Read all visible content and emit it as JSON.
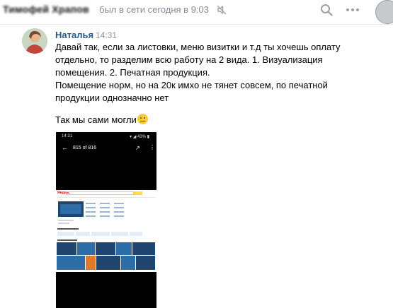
{
  "header": {
    "contact_name": "Тимофей Храпов",
    "status": "был в сети сегодня в 9:03"
  },
  "message": {
    "sender": "Наталья",
    "time": "14:31",
    "lines": [
      "Давай так, если за листовки, меню визитки и т.д ты хочешь оплату",
      "отдельно, то разделим всю работу на 2 вида. 1. Визуализация",
      "помещения. 2. Печатная продукция.",
      "Помещение норм, но на 20к имхо не тянет совсем, по печатной",
      "продукции однозначно нет"
    ],
    "second_text": "Так мы сами могли"
  },
  "attachment": {
    "status_time": "14:31",
    "status_right": "▾ ◢ 43% ▮",
    "counter": "815 of 816",
    "logo": "Яндекс"
  },
  "icons": {
    "mute": "mute-icon",
    "search": "search-icon",
    "more": "more-icon",
    "emoji": "neutral-face-emoji-icon"
  },
  "colors": {
    "sender_name": "#2a5885",
    "status_text": "#818c99",
    "timestamp": "#939393"
  }
}
